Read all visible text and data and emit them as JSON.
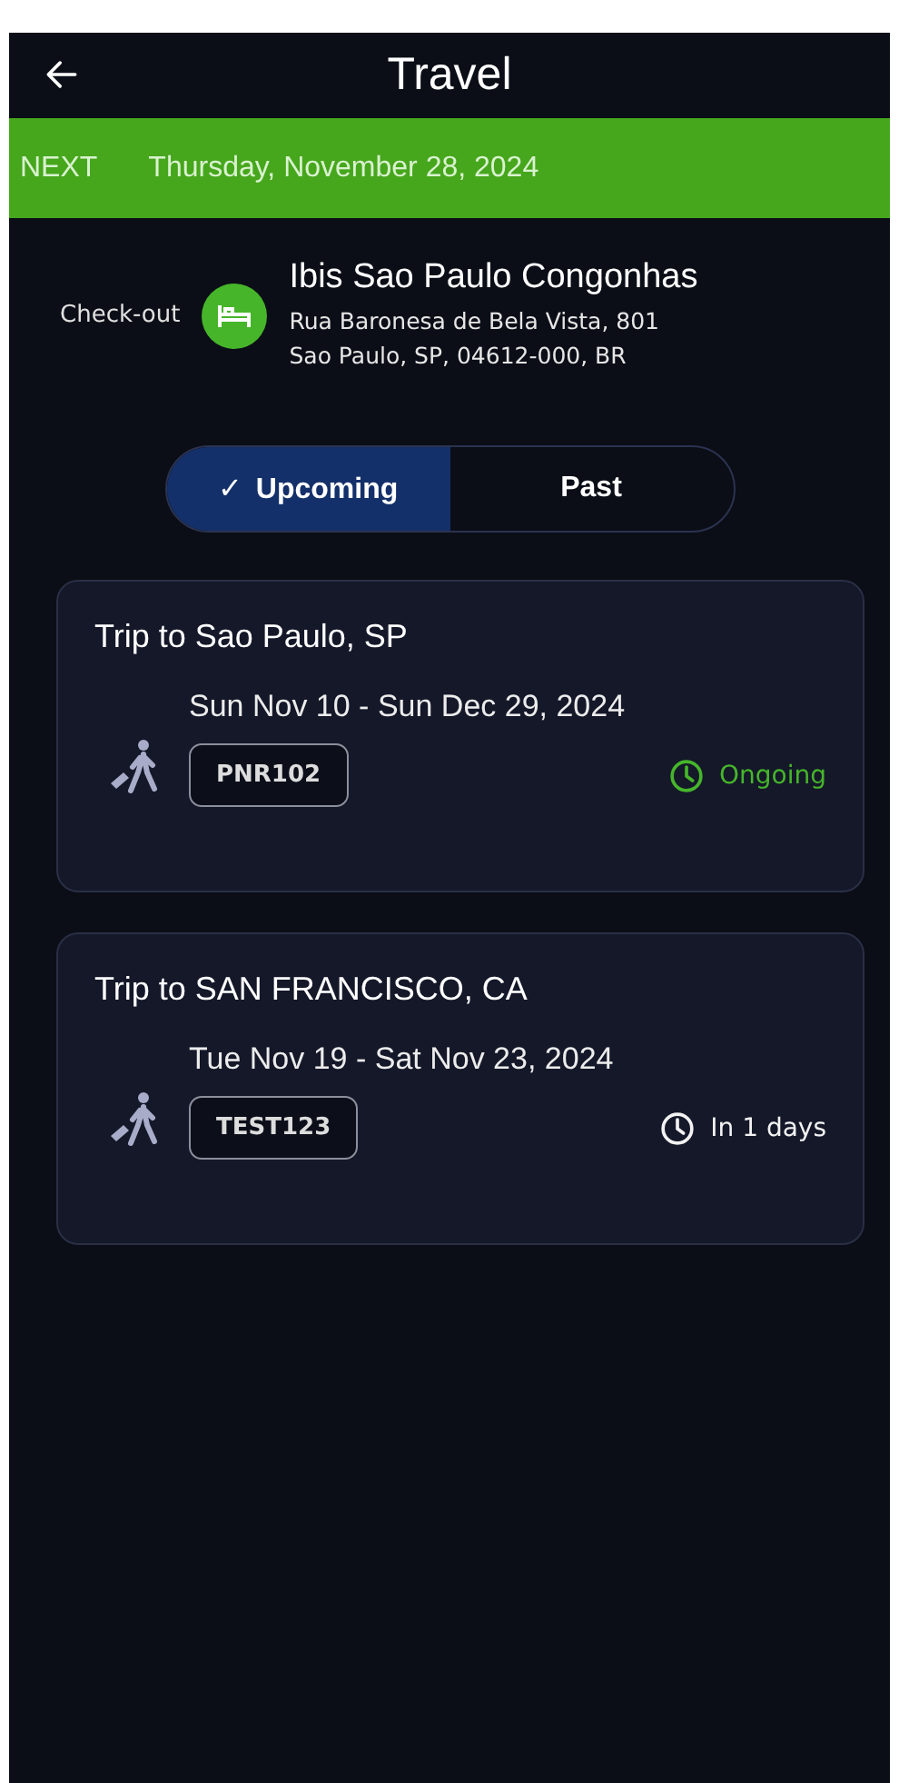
{
  "header": {
    "title": "Travel"
  },
  "next_banner": {
    "label": "NEXT",
    "date": "Thursday, November 28, 2024"
  },
  "next_event": {
    "label": "Check-out",
    "name": "Ibis Sao Paulo Congonhas",
    "address_lines": [
      "Rua Baronesa de Bela Vista, 801",
      "Sao Paulo, SP, 04612-000, BR"
    ]
  },
  "tabs": [
    {
      "label": "Upcoming",
      "check": "✓",
      "selected": true
    },
    {
      "label": "Past",
      "selected": false
    }
  ],
  "trips": [
    {
      "title": "Trip to Sao Paulo, SP",
      "dates": "Sun Nov 10 - Sun Dec 29, 2024",
      "code": "PNR102",
      "status": "Ongoing",
      "kind": "ongoing"
    },
    {
      "title": "Trip to SAN FRANCISCO, CA",
      "dates": "Tue Nov 19 - Sat Nov 23, 2024",
      "code": "TEST123",
      "status": "In 1 days",
      "kind": "upcoming"
    }
  ]
}
